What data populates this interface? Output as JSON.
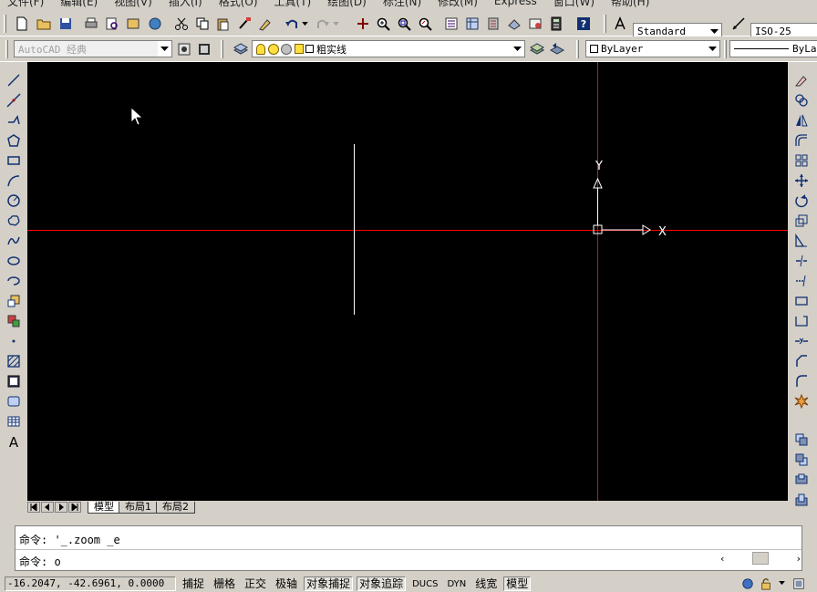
{
  "menu": [
    "文件(F)",
    "编辑(E)",
    "视图(V)",
    "插入(I)",
    "格式(O)",
    "工具(T)",
    "绘图(D)",
    "标注(N)",
    "修改(M)",
    "Express",
    "窗口(W)",
    "帮助(H)"
  ],
  "toolbar_top": {
    "text_style": "Standard",
    "dim_style": "ISO-25"
  },
  "toolbar_second": {
    "workspace": "AutoCAD 经典",
    "layer": "粗实线",
    "color": "ByLayer",
    "linetype": "ByLa"
  },
  "canvas": {
    "ucs_y_label": "Y",
    "ucs_x_label": "X",
    "crosshair_color": "#ff0000"
  },
  "tabs": [
    "模型",
    "布局1",
    "布局2"
  ],
  "command": {
    "history": "命令: '_.zoom _e",
    "current": "命令: o"
  },
  "status": {
    "coords": "-16.2047, -42.6961, 0.0000",
    "toggles": [
      {
        "label": "捕捉",
        "on": false
      },
      {
        "label": "栅格",
        "on": false
      },
      {
        "label": "正交",
        "on": false
      },
      {
        "label": "极轴",
        "on": false
      },
      {
        "label": "对象捕捉",
        "on": true
      },
      {
        "label": "对象追踪",
        "on": true
      },
      {
        "label": "DUCS",
        "on": false
      },
      {
        "label": "DYN",
        "on": false
      },
      {
        "label": "线宽",
        "on": false
      },
      {
        "label": "模型",
        "on": true
      }
    ]
  }
}
